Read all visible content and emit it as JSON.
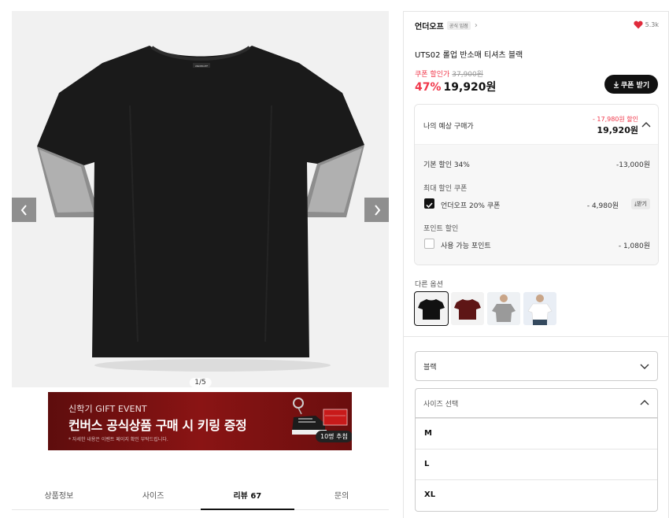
{
  "gallery": {
    "counter": "1/5",
    "prev_icon": "chevron-left-icon",
    "next_icon": "chevron-right-icon",
    "shirt_tag": "UNDEROFF"
  },
  "banner": {
    "eyebrow": "신학기 GIFT EVENT",
    "title": "컨버스 공식상품 구매 시 키링 증정",
    "note": "* 자세한 내용은 이벤트 페이지 확인 부탁드립니다.",
    "badge": "10명 추첨"
  },
  "tabs": [
    {
      "label": "상품정보"
    },
    {
      "label": "사이즈"
    },
    {
      "label": "리뷰 67"
    },
    {
      "label": "문의"
    }
  ],
  "product": {
    "brand": "언더오프",
    "official_badge": "공식 입점",
    "like_count": "5.3k",
    "name": "UTS02 롤업 반소매 티셔츠 블랙",
    "coupon_label": "쿠폰 할인가",
    "original_price": "37,900원",
    "discount": "47%",
    "price": "19,920원",
    "coupon_button": "쿠폰 받기"
  },
  "estimate": {
    "label": "나의 예상 구매가",
    "saving": "- 17,980원 할인",
    "price": "19,920원",
    "basic_label": "기본 할인 34%",
    "basic_value": "-13,000원",
    "max_coupon_title": "최대 할인 쿠폰",
    "coupon_name": "언더오프 20% 쿠폰",
    "coupon_value": "- 4,980원",
    "coupon_get": "받기",
    "point_title": "포인트 할인",
    "point_name": "사용 가능 포인트",
    "point_value": "- 1,080원"
  },
  "options": {
    "title": "다른 옵션",
    "swatches": [
      "black",
      "burgundy",
      "gray",
      "white"
    ]
  },
  "selects": {
    "color": "블랙",
    "size_placeholder": "사이즈 선택",
    "sizes": [
      "M",
      "L",
      "XL"
    ]
  },
  "colors": {
    "accent_red": "#f0374a",
    "banner_red": "#8a1414",
    "shirt_black": "#1a1a1a"
  }
}
